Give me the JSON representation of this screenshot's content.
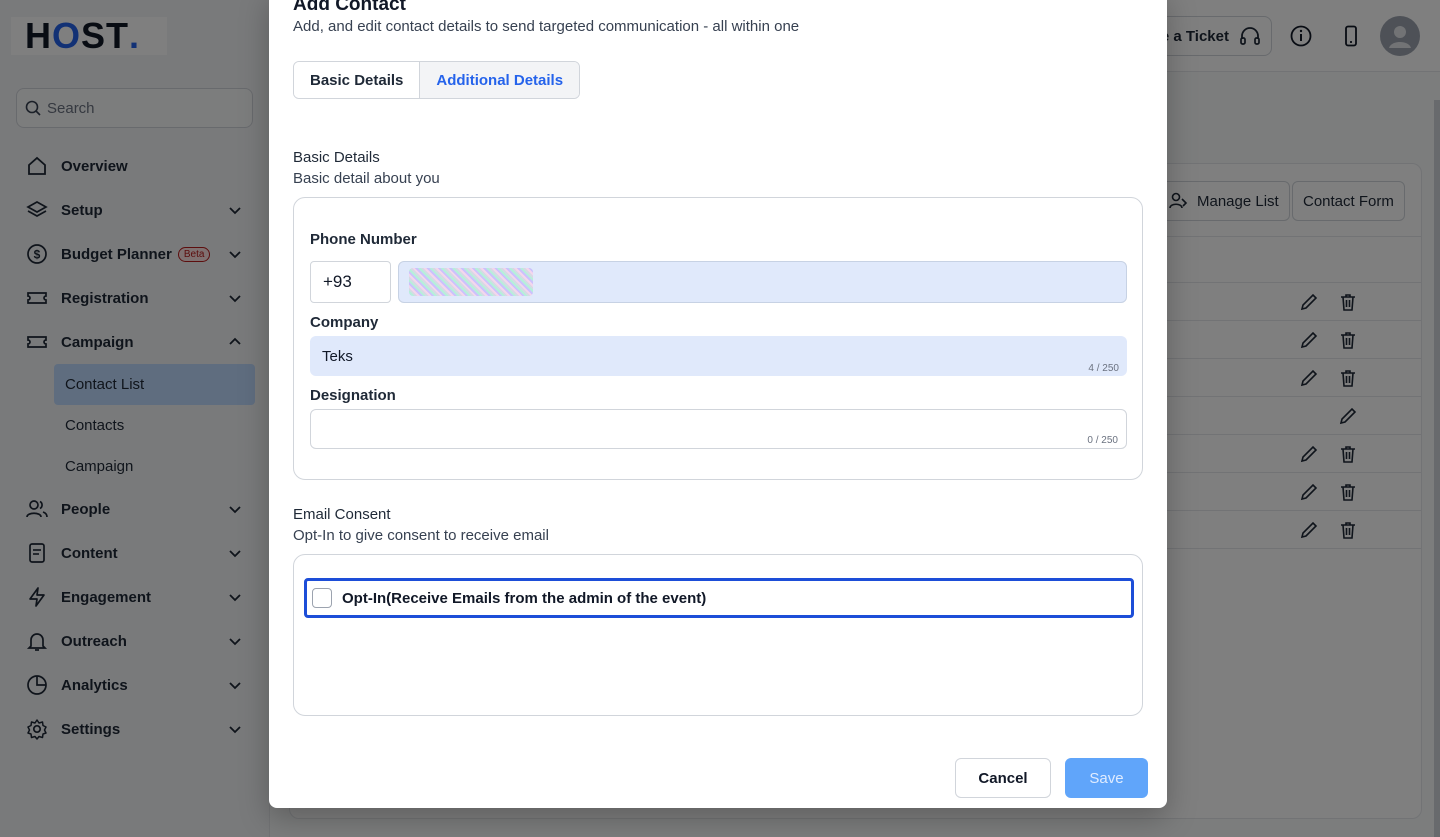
{
  "brand": {
    "logo_text": "HOST."
  },
  "sidebar": {
    "search_placeholder": "Search",
    "items": [
      {
        "label": "Overview",
        "icon": "home-icon"
      },
      {
        "label": "Setup",
        "icon": "layers-icon"
      },
      {
        "label": "Budget Planner",
        "badge": "Beta",
        "icon": "dollar-icon"
      },
      {
        "label": "Registration",
        "icon": "ticket-icon"
      },
      {
        "label": "Campaign",
        "icon": "ticket-icon"
      },
      {
        "label": "People",
        "icon": "users-icon"
      },
      {
        "label": "Content",
        "icon": "document-icon"
      },
      {
        "label": "Engagement",
        "icon": "lightning-icon"
      },
      {
        "label": "Outreach",
        "icon": "bell-icon"
      },
      {
        "label": "Analytics",
        "icon": "pie-chart-icon"
      },
      {
        "label": "Settings",
        "icon": "gear-icon"
      }
    ],
    "campaign_sub": [
      {
        "label": "Contact List",
        "active": true
      },
      {
        "label": "Contacts"
      },
      {
        "label": "Campaign"
      }
    ]
  },
  "topbar": {
    "ticket_label": "e a Ticket"
  },
  "background": {
    "manage_list_label": "Manage List",
    "contact_form_label": "Contact Form"
  },
  "modal": {
    "title": "Add Contact",
    "subtitle": "Add, and edit contact details to send targeted communication - all within one",
    "tabs": [
      {
        "label": "Basic Details"
      },
      {
        "label": "Additional Details",
        "active": true
      }
    ],
    "basic_section": {
      "title": "Basic Details",
      "description": "Basic detail about you"
    },
    "phone_label": "Phone Number",
    "phone_code": "+93",
    "company_label": "Company",
    "company_value": "Teks",
    "company_counter": "4 / 250",
    "designation_label": "Designation",
    "designation_value": "",
    "designation_counter": "0 / 250",
    "consent_section": {
      "title": "Email Consent",
      "description": "Opt-In to give consent to receive email"
    },
    "consent_label": "Opt-In(Receive Emails from the admin of the event)",
    "consent_checked": false,
    "cancel_label": "Cancel",
    "save_label": "Save"
  },
  "colors": {
    "accent": "#2563eb",
    "save_disabled": "#60a5fa",
    "filled_field": "#e0e9fb"
  }
}
